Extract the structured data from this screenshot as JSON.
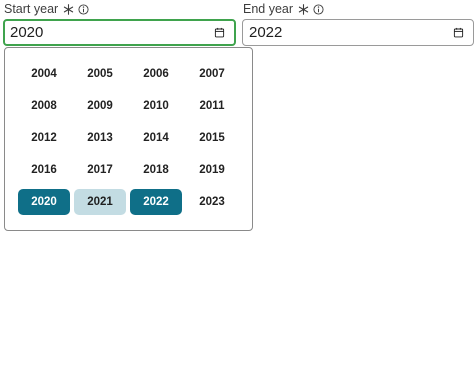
{
  "start_year": {
    "label": "Start year",
    "value": "2020",
    "required_icon": "asterisk-icon",
    "info_icon": "info-icon",
    "calendar_icon": "calendar-icon"
  },
  "end_year": {
    "label": "End year",
    "value": "2022",
    "required_icon": "asterisk-icon",
    "info_icon": "info-icon",
    "calendar_icon": "calendar-icon"
  },
  "picker": {
    "years": [
      {
        "label": "2004",
        "state": "normal"
      },
      {
        "label": "2005",
        "state": "normal"
      },
      {
        "label": "2006",
        "state": "normal"
      },
      {
        "label": "2007",
        "state": "normal"
      },
      {
        "label": "2008",
        "state": "normal"
      },
      {
        "label": "2009",
        "state": "normal"
      },
      {
        "label": "2010",
        "state": "normal"
      },
      {
        "label": "2011",
        "state": "normal"
      },
      {
        "label": "2012",
        "state": "normal"
      },
      {
        "label": "2013",
        "state": "normal"
      },
      {
        "label": "2014",
        "state": "normal"
      },
      {
        "label": "2015",
        "state": "normal"
      },
      {
        "label": "2016",
        "state": "normal"
      },
      {
        "label": "2017",
        "state": "normal"
      },
      {
        "label": "2018",
        "state": "normal"
      },
      {
        "label": "2019",
        "state": "normal"
      },
      {
        "label": "2020",
        "state": "selected"
      },
      {
        "label": "2021",
        "state": "in-range"
      },
      {
        "label": "2022",
        "state": "selected"
      },
      {
        "label": "2023",
        "state": "normal"
      }
    ]
  },
  "colors": {
    "focus_border": "#3fa34d",
    "selected_bg": "#0f6f88",
    "range_bg": "#c3dce3"
  }
}
